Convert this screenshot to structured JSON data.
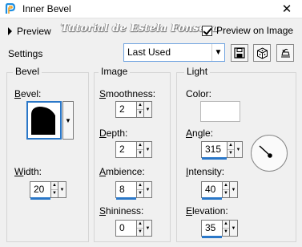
{
  "window": {
    "title": "Inner Bevel",
    "close_glyph": "✕"
  },
  "preview": {
    "label": "Preview",
    "watermark": "Tutorial de Estela Fonseca",
    "preview_on_image_label": "Preview on Image",
    "preview_on_image_checked": true
  },
  "settings": {
    "label": "Settings",
    "preset_value": "Last Used"
  },
  "bevel_group": {
    "title": "Bevel",
    "bevel_label_u": "B",
    "bevel_label_rest": "evel:",
    "width_label_u": "W",
    "width_label_rest": "idth:",
    "width_value": "20"
  },
  "image_group": {
    "title": "Image",
    "smoothness_label_u": "S",
    "smoothness_label_rest": "moothness:",
    "smoothness_value": "2",
    "depth_label_u": "D",
    "depth_label_rest": "epth:",
    "depth_value": "2",
    "ambience_label_u": "A",
    "ambience_label_rest": "mbience:",
    "ambience_value": "8",
    "shininess_label_u": "S",
    "shininess_label_rest": "hininess:",
    "shininess_value": "0"
  },
  "light_group": {
    "title": "Light",
    "color_label": "Color:",
    "color_value": "#ffffff",
    "angle_label_u": "A",
    "angle_label_rest": "ngle:",
    "angle_value": "315",
    "intensity_label_u": "I",
    "intensity_label_rest": "ntensity:",
    "intensity_value": "40",
    "elevation_label_u": "E",
    "elevation_label_rest": "levation:",
    "elevation_value": "35"
  },
  "colors": {
    "accent": "#2a77c8",
    "background": "#f0f0f0"
  }
}
